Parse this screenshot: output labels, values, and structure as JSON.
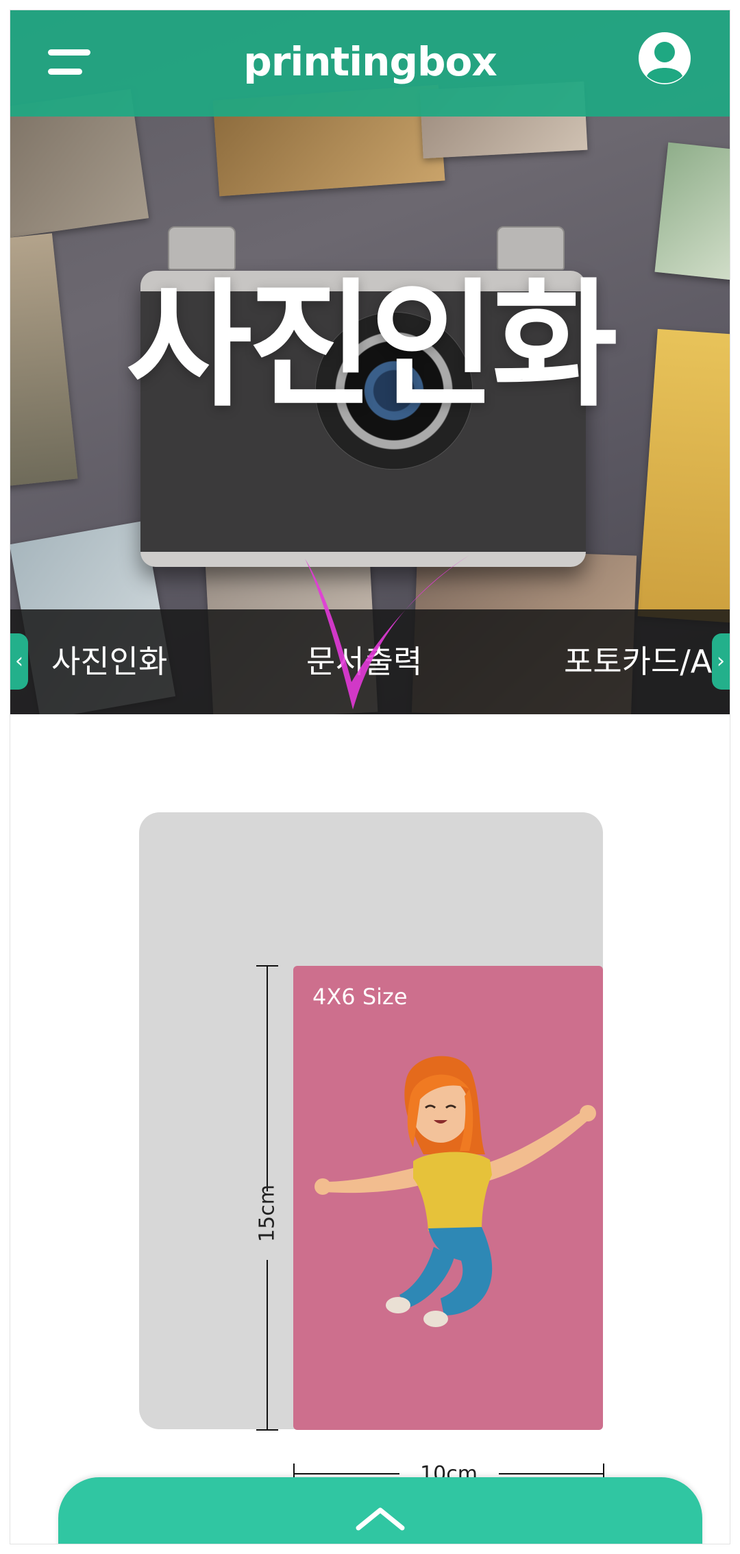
{
  "app": {
    "logo": "printingbox"
  },
  "colors": {
    "primary": "#1fa882",
    "sheet": "#30c6a2",
    "photo_bg": "#cd6f8d",
    "card_bg": "#d7d7d7",
    "check_mark": "#e23ad8"
  },
  "hero": {
    "title": "사진인화"
  },
  "categories": {
    "items": [
      "사진인화",
      "문서출력",
      "포토카드/A"
    ]
  },
  "icons": {
    "menu": "menu-icon",
    "profile": "user-profile-icon",
    "prev": "chevron-left-icon",
    "next": "chevron-right-icon",
    "sheet": "chevron-up-icon"
  },
  "size_diagram": {
    "label": "4X6 Size",
    "height_label": "15cm",
    "width_label": "10cm"
  }
}
